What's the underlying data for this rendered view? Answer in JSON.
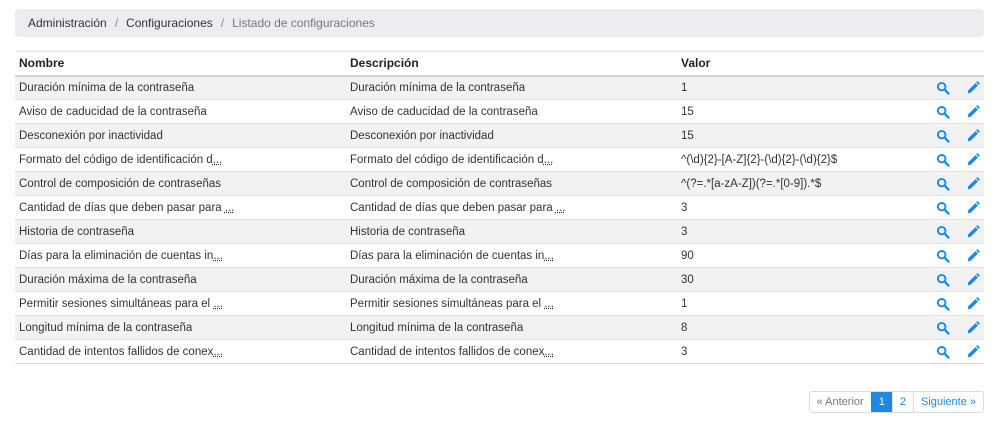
{
  "breadcrumb": {
    "items": [
      "Administración",
      "Configuraciones"
    ],
    "separator": "/",
    "current": "Listado de configuraciones"
  },
  "table": {
    "headers": {
      "name": "Nombre",
      "description": "Descripción",
      "value": "Valor"
    },
    "rows": [
      {
        "name": "Duración mínima de la contraseña",
        "name_trunc": "",
        "description": "Duración mínima de la contraseña",
        "description_trunc": "",
        "value": "1"
      },
      {
        "name": "Aviso de caducidad de la contraseña",
        "name_trunc": "",
        "description": "Aviso de caducidad de la contraseña",
        "description_trunc": "",
        "value": "15"
      },
      {
        "name": "Desconexión por inactividad",
        "name_trunc": "",
        "description": "Desconexión por inactividad",
        "description_trunc": "",
        "value": "15"
      },
      {
        "name": "Formato del código de identificación d",
        "name_trunc": "...",
        "description": "Formato del código de identificación d",
        "description_trunc": "...",
        "value": "^(\\d){2}-[A-Z]{2}-(\\d){2}-(\\d){2}$"
      },
      {
        "name": "Control de composición de contraseñas",
        "name_trunc": "",
        "description": "Control de composición de contraseñas",
        "description_trunc": "",
        "value": "^(?=.*[a-zA-Z])(?=.*[0-9]).*$"
      },
      {
        "name": "Cantidad de días que deben pasar para ",
        "name_trunc": "...",
        "description": "Cantidad de días que deben pasar para ",
        "description_trunc": "...",
        "value": "3"
      },
      {
        "name": "Historia de contraseña",
        "name_trunc": "",
        "description": "Historia de contraseña",
        "description_trunc": "",
        "value": "3"
      },
      {
        "name": "Días para la eliminación de cuentas in",
        "name_trunc": "...",
        "description": "Días para la eliminación de cuentas in",
        "description_trunc": "...",
        "value": "90"
      },
      {
        "name": "Duración máxima de la contraseña",
        "name_trunc": "",
        "description": "Duración máxima de la contraseña",
        "description_trunc": "",
        "value": "30"
      },
      {
        "name": "Permitir sesiones simultáneas para el ",
        "name_trunc": "...",
        "description": "Permitir sesiones simultáneas para el ",
        "description_trunc": "...",
        "value": "1"
      },
      {
        "name": "Longitud mínima de la contraseña",
        "name_trunc": "",
        "description": "Longitud mínima de la contraseña",
        "description_trunc": "",
        "value": "8"
      },
      {
        "name": "Cantidad de intentos fallidos de conex",
        "name_trunc": "...",
        "description": "Cantidad de intentos fallidos de conex",
        "description_trunc": "...",
        "value": "3"
      }
    ],
    "row_actions": [
      {
        "icon": "search-icon"
      },
      {
        "icon": "pencil-icon"
      }
    ]
  },
  "pagination": {
    "prev": "« Anterior",
    "pages": [
      "1",
      "2"
    ],
    "current": "1",
    "next": "Siguiente »"
  },
  "colors": {
    "accent": "#1e88e5",
    "breadcrumb_bg": "#ebedf0",
    "stripe": "#f2f2f2"
  }
}
